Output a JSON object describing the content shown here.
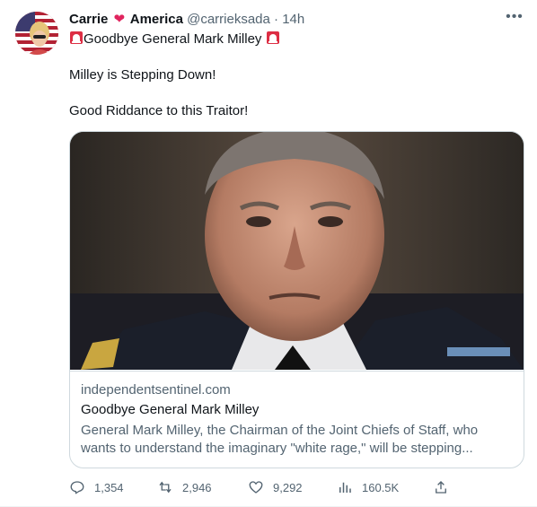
{
  "tweet": {
    "display_name_first": "Carrie",
    "display_name_second": "America",
    "handle": "@carrieksada",
    "separator": "·",
    "time": "14h",
    "more_label": "•••",
    "headline": "Goodbye General Mark Milley",
    "line1": "Milley is Stepping Down!",
    "line2": "Good Riddance to this Traitor!"
  },
  "card": {
    "domain": "independentsentinel.com",
    "title": "Goodbye General Mark Milley",
    "description": "General Mark Milley, the Chairman of the Joint Chiefs of Staff, who wants to understand the imaginary \"white rage,\" will be stepping..."
  },
  "actions": {
    "replies": "1,354",
    "retweets": "2,946",
    "likes": "9,292",
    "views": "160.5K"
  },
  "icons": {
    "heart": "red-heart-icon",
    "siren": "rotating-light-icon",
    "reply": "reply-icon",
    "retweet": "retweet-icon",
    "like": "like-icon",
    "views": "views-icon",
    "share": "share-icon"
  },
  "colors": {
    "heart": "#e0245e",
    "secondary_text": "#536471",
    "border": "#cfd9de"
  }
}
